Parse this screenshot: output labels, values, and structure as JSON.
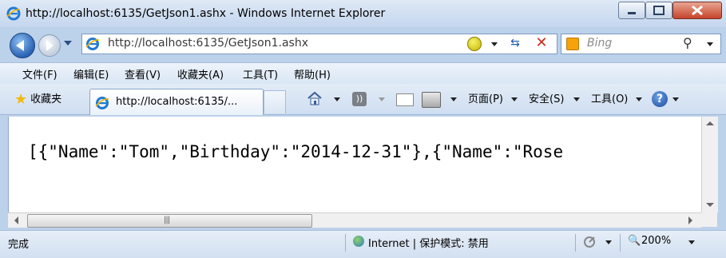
{
  "window": {
    "title": "http://localhost:6135/GetJson1.ashx - Windows Internet Explorer"
  },
  "address_bar": {
    "url": "http://localhost:6135/GetJson1.ashx",
    "search_placeholder": "Bing"
  },
  "menu": {
    "items": [
      "文件(F)",
      "编辑(E)",
      "查看(V)",
      "收藏夹(A)",
      "工具(T)",
      "帮助(H)"
    ]
  },
  "favorites": {
    "label": "收藏夹"
  },
  "tab": {
    "label": "http://localhost:6135/..."
  },
  "command_bar": {
    "page": "页面(P)",
    "safety": "安全(S)",
    "tools": "工具(O)"
  },
  "content": {
    "text": "[{\"Name\":\"Tom\",\"Birthday\":\"2014-12-31\"},{\"Name\":\"Rose"
  },
  "status_bar": {
    "status": "完成",
    "zone": "Internet | 保护模式: 禁用",
    "zoom": "200%"
  },
  "icons": [
    "ie-icon",
    "back-icon",
    "forward-icon",
    "compat-view-icon",
    "refresh-icon",
    "stop-icon",
    "bing-icon",
    "search-icon",
    "favorites-star-icon",
    "home-icon",
    "rss-icon",
    "mail-icon",
    "print-icon",
    "help-icon",
    "globe-icon",
    "zoom-icon"
  ]
}
